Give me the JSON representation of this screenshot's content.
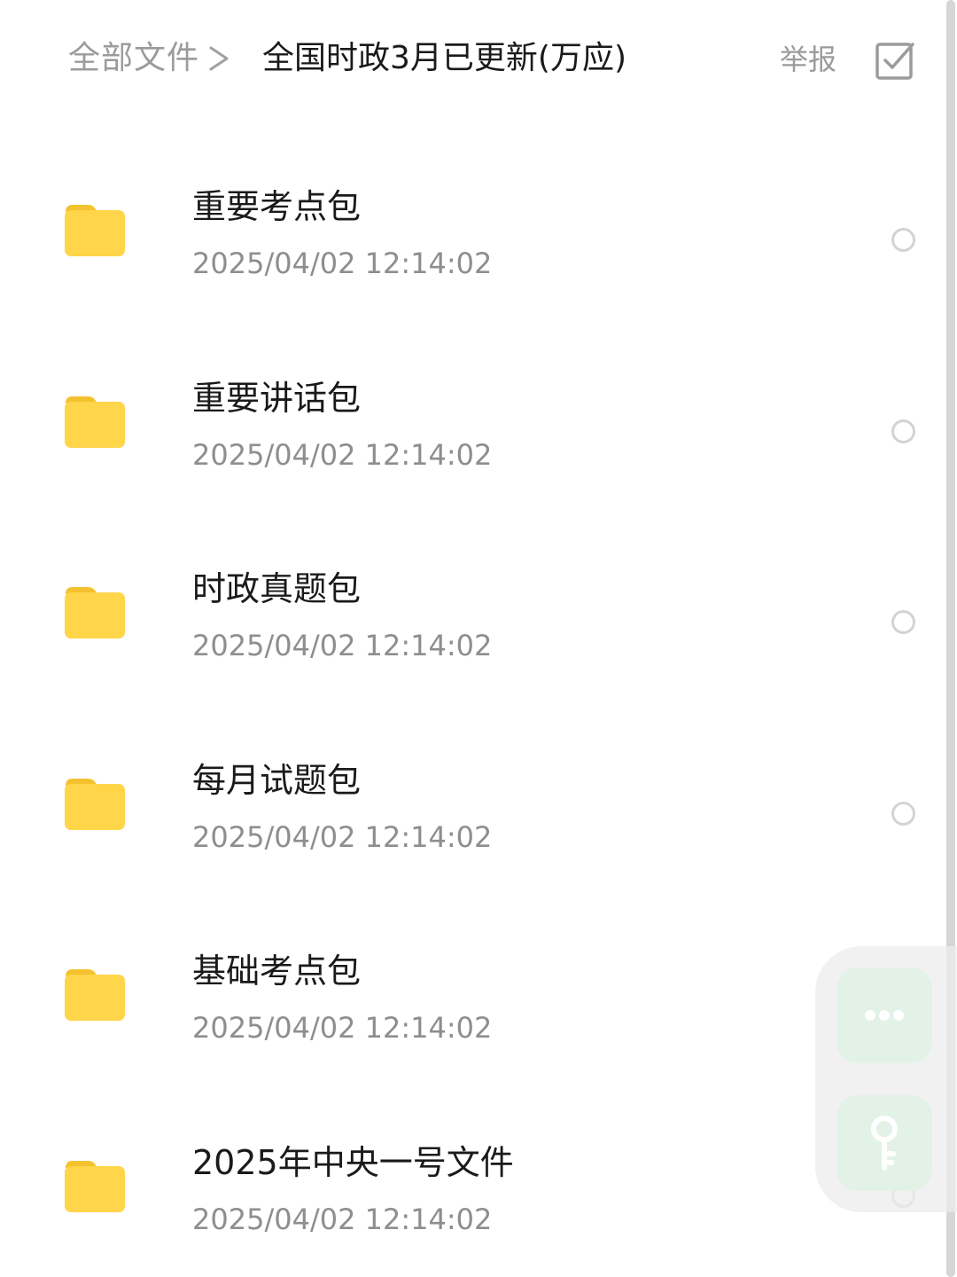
{
  "header": {
    "breadcrumb_root": "全部文件",
    "breadcrumb_current": "全国时政3月已更新(万应)",
    "report_label": "举报"
  },
  "files": [
    {
      "name": "重要考点包",
      "date": "2025/04/02  12:14:02"
    },
    {
      "name": "重要讲话包",
      "date": "2025/04/02  12:14:02"
    },
    {
      "name": "时政真题包",
      "date": "2025/04/02  12:14:02"
    },
    {
      "name": "每月试题包",
      "date": "2025/04/02  12:14:02"
    },
    {
      "name": "基础考点包",
      "date": "2025/04/02  12:14:02"
    },
    {
      "name": "2025年中央一号文件",
      "date": "2025/04/02  12:14:02"
    }
  ],
  "icons": {
    "folder": "folder-icon",
    "separator": "chevron-right-icon",
    "multi_select": "checkbox-icon",
    "more": "more-icon",
    "key": "key-icon"
  },
  "colors": {
    "folder": "#FFD54A",
    "folder_tab": "#F5C22F",
    "primary_text": "#1A1A1A",
    "secondary_text": "#8E8E8E",
    "floating_button": "#E0F2E4"
  }
}
